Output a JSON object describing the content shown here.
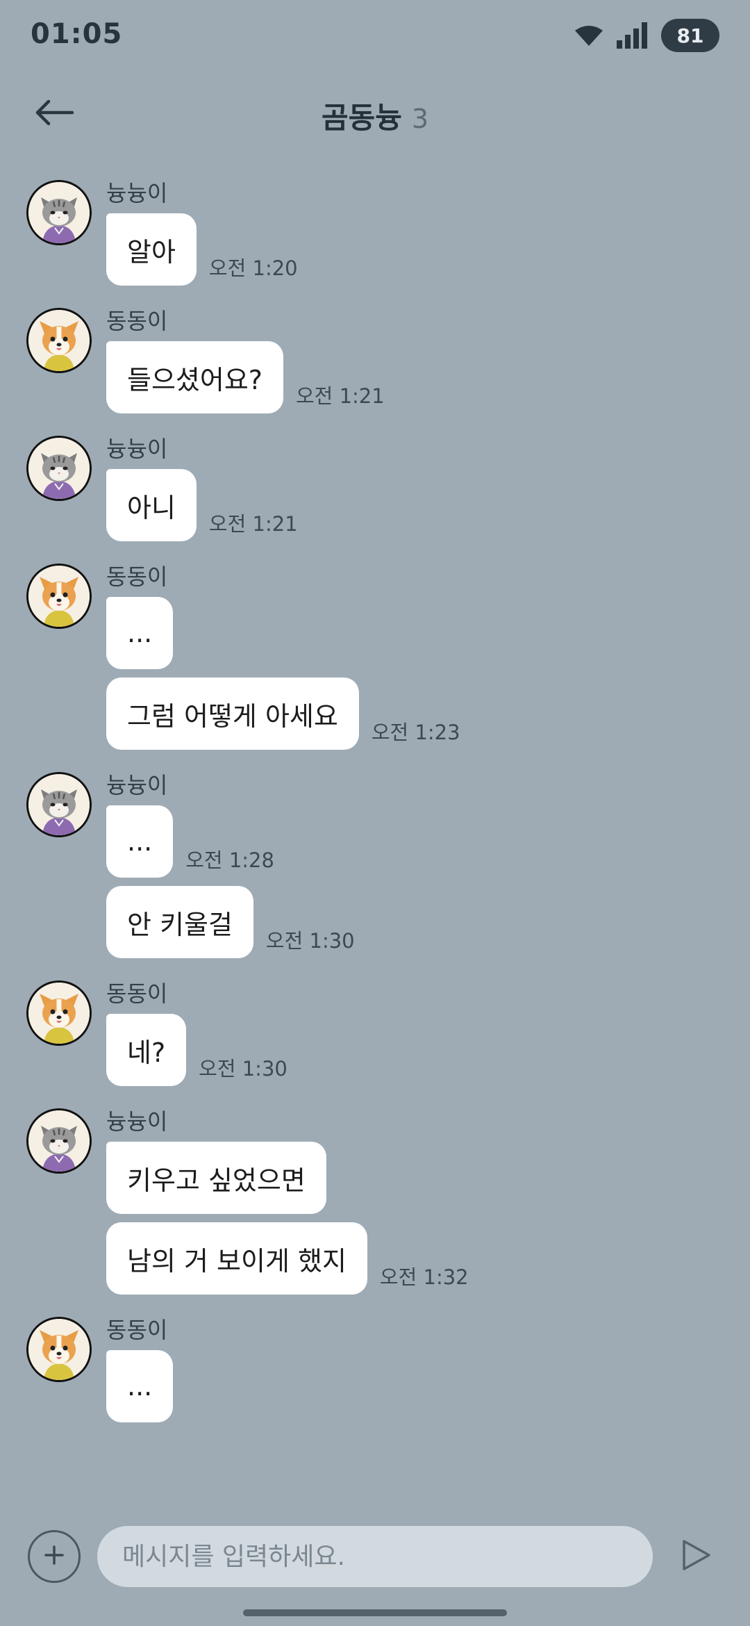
{
  "status_bar": {
    "time": "01:05",
    "battery": "81"
  },
  "header": {
    "title": "곰동늉",
    "member_count": "3"
  },
  "messages": [
    {
      "sender": "늉늉이",
      "avatar_icon": "cat-avatar-icon",
      "bubbles": [
        {
          "text": "알아",
          "time": "오전 1:20"
        }
      ]
    },
    {
      "sender": "동동이",
      "avatar_icon": "dog-avatar-icon",
      "bubbles": [
        {
          "text": "들으셨어요?",
          "time": "오전 1:21"
        }
      ]
    },
    {
      "sender": "늉늉이",
      "avatar_icon": "cat-avatar-icon",
      "bubbles": [
        {
          "text": "아니",
          "time": "오전 1:21"
        }
      ]
    },
    {
      "sender": "동동이",
      "avatar_icon": "dog-avatar-icon",
      "bubbles": [
        {
          "text": "...",
          "time": ""
        },
        {
          "text": "그럼 어떻게 아세요",
          "time": "오전 1:23"
        }
      ]
    },
    {
      "sender": "늉늉이",
      "avatar_icon": "cat-avatar-icon",
      "bubbles": [
        {
          "text": "...",
          "time": "오전 1:28"
        },
        {
          "text": "안 키울걸",
          "time": "오전 1:30"
        }
      ]
    },
    {
      "sender": "동동이",
      "avatar_icon": "dog-avatar-icon",
      "bubbles": [
        {
          "text": "네?",
          "time": "오전 1:30"
        }
      ]
    },
    {
      "sender": "늉늉이",
      "avatar_icon": "cat-avatar-icon",
      "bubbles": [
        {
          "text": "키우고 싶었으면",
          "time": ""
        },
        {
          "text": "남의 거 보이게 했지",
          "time": "오전 1:32"
        }
      ]
    },
    {
      "sender": "동동이",
      "avatar_icon": "dog-avatar-icon",
      "bubbles": [
        {
          "text": "...",
          "time": ""
        }
      ]
    }
  ],
  "input": {
    "placeholder": "메시지를 입력하세요.",
    "value": ""
  },
  "colors": {
    "background": "#9eabb5",
    "bubble": "#ffffff",
    "input_background": "#d2dae0",
    "battery_badge": "#2f3b45"
  },
  "icons": {
    "back": "back-arrow-icon",
    "plus": "plus-icon",
    "send": "send-icon",
    "wifi": "wifi-icon",
    "signal": "signal-icon"
  }
}
